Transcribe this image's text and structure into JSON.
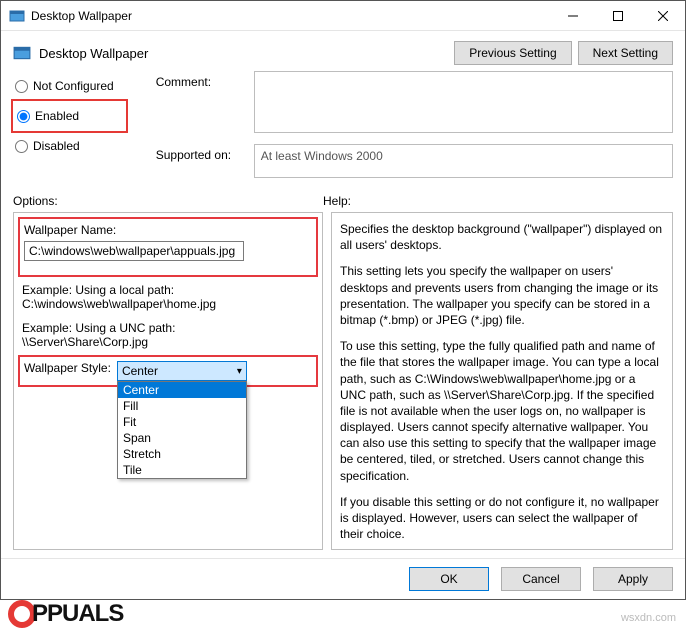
{
  "title": "Desktop Wallpaper",
  "header": {
    "title": "Desktop Wallpaper",
    "prev": "Previous Setting",
    "next": "Next Setting"
  },
  "radios": {
    "not_configured": "Not Configured",
    "enabled": "Enabled",
    "disabled": "Disabled",
    "selected": "enabled"
  },
  "labels": {
    "comment": "Comment:",
    "supported": "Supported on:",
    "options": "Options:",
    "help": "Help:"
  },
  "supported_text": "At least Windows 2000",
  "options": {
    "wallpaper_name_label": "Wallpaper Name:",
    "wallpaper_name_value": "C:\\windows\\web\\wallpaper\\appuals.jpg",
    "example_local_label": "Example: Using a local path:",
    "example_local_value": "C:\\windows\\web\\wallpaper\\home.jpg",
    "example_unc_label": "Example: Using a UNC path:",
    "example_unc_value": "\\\\Server\\Share\\Corp.jpg",
    "style_label": "Wallpaper Style:",
    "style_selected": "Center",
    "style_options": [
      "Center",
      "Fill",
      "Fit",
      "Span",
      "Stretch",
      "Tile"
    ]
  },
  "help": {
    "p1": "Specifies the desktop background (\"wallpaper\") displayed on all users' desktops.",
    "p2": "This setting lets you specify the wallpaper on users' desktops and prevents users from changing the image or its presentation. The wallpaper you specify can be stored in a bitmap (*.bmp) or JPEG (*.jpg) file.",
    "p3": "To use this setting, type the fully qualified path and name of the file that stores the wallpaper image. You can type a local path, such as C:\\Windows\\web\\wallpaper\\home.jpg or a UNC path, such as \\\\Server\\Share\\Corp.jpg. If the specified file is not available when the user logs on, no wallpaper is displayed. Users cannot specify alternative wallpaper. You can also use this setting to specify that the wallpaper image be centered, tiled, or stretched. Users cannot change this specification.",
    "p4": "If you disable this setting or do not configure it, no wallpaper is displayed. However, users can select the wallpaper of their choice."
  },
  "footer": {
    "ok": "OK",
    "cancel": "Cancel",
    "apply": "Apply"
  },
  "wsx": "wsxdn.com"
}
